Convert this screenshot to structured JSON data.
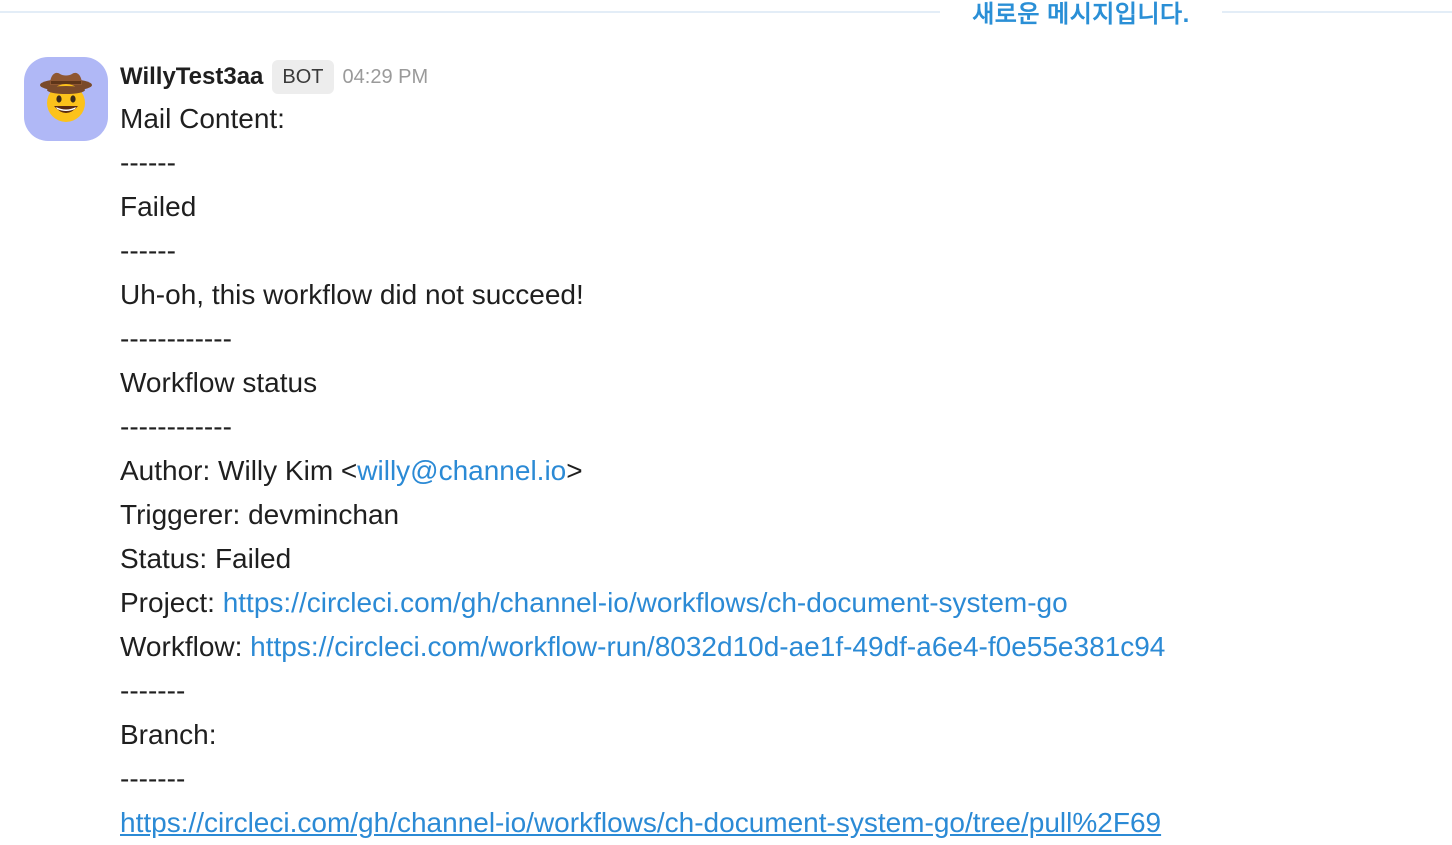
{
  "divider": {
    "label": "새로운 메시지입니다."
  },
  "message": {
    "author": "WillyTest3aa",
    "badge": "BOT",
    "time": "04:29 PM",
    "avatar_icon": "cowboy-emoji-icon",
    "lines": {
      "l1": "Mail Content:",
      "l2": "------",
      "l3": "Failed",
      "l4": "------",
      "l5": "Uh-oh, this workflow did not succeed!",
      "l6": "------------",
      "l7": "Workflow status",
      "l8": "------------",
      "author_prefix": "Author: Willy Kim <",
      "author_email": "willy@channel.io",
      "author_suffix": ">",
      "triggerer": "Triggerer: devminchan",
      "status": "Status: Failed",
      "project_prefix": "Project: ",
      "project_url": "https://circleci.com/gh/channel-io/workflows/ch-document-system-go",
      "workflow_prefix": "Workflow: ",
      "workflow_url": "https://circleci.com/workflow-run/8032d10d-ae1f-49df-a6e4-f0e55e381c94",
      "l15": "-------",
      "branch": "Branch:",
      "l17": "-------",
      "branch_url": "https://circleci.com/gh/channel-io/workflows/ch-document-system-go/tree/pull%2F69"
    }
  },
  "colors": {
    "link": "#2b8ad5",
    "divider_label": "#2a8fd6",
    "avatar_bg": "#b0b8f6"
  }
}
